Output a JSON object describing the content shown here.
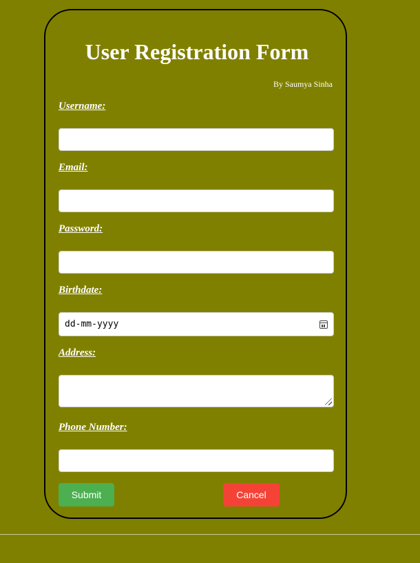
{
  "form": {
    "title": "User Registration Form",
    "byline": "By Saumya Sinha",
    "fields": {
      "username": {
        "label": "Username:",
        "value": ""
      },
      "email": {
        "label": "Email:",
        "value": ""
      },
      "password": {
        "label": "Password:",
        "value": ""
      },
      "birthdate": {
        "label": "Birthdate:",
        "placeholder": "dd-mm-yyyy",
        "icon": "calendar-icon"
      },
      "address": {
        "label": "Address:",
        "value": ""
      },
      "phone": {
        "label": "Phone Number:",
        "value": ""
      }
    },
    "buttons": {
      "submit_label": "Submit",
      "cancel_label": "Cancel"
    },
    "colors": {
      "background": "#808000",
      "submit": "#4caf50",
      "cancel": "#f44336"
    }
  }
}
